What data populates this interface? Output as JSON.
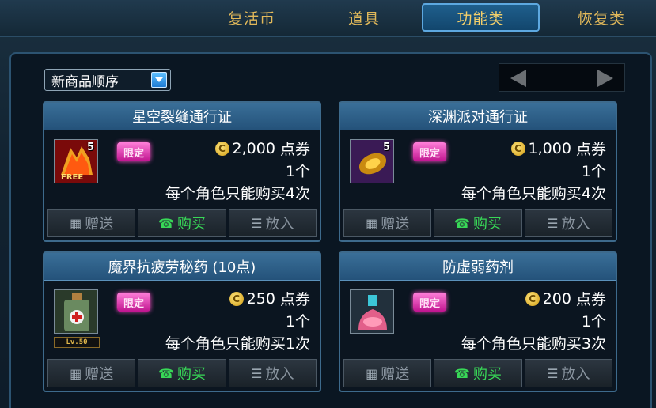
{
  "tabs": [
    {
      "label": "复活币"
    },
    {
      "label": "道具"
    },
    {
      "label": "功能类",
      "active": true
    },
    {
      "label": "恢复类"
    }
  ],
  "sort": {
    "label": "新商品顺序"
  },
  "currency_unit": "点券",
  "limited_label": "限定",
  "buttons": {
    "gift": "赠送",
    "buy": "购买",
    "cart": "放入"
  },
  "items": [
    {
      "name": "星空裂缝通行证",
      "price": "2,000",
      "qty": "1个",
      "limit": "每个角色只能购买4次",
      "badge": "5",
      "icon": "fist-pass-icon"
    },
    {
      "name": "深渊派对通行证",
      "price": "1,000",
      "qty": "1个",
      "limit": "每个角色只能购买4次",
      "badge": "5",
      "icon": "abyss-pass-icon"
    },
    {
      "name": "魔界抗疲劳秘药 (10点)",
      "price": "250",
      "qty": "1个",
      "limit": "每个角色只能购买1次",
      "level": "Lv.50",
      "icon": "potion-bottle-icon"
    },
    {
      "name": "防虚弱药剂",
      "price": "200",
      "qty": "1个",
      "limit": "每个角色只能购买3次",
      "icon": "flask-icon"
    }
  ],
  "colors": {
    "accent": "#f4cf6a",
    "buy_green": "#38d857",
    "limited_pink": "#ff4fc9"
  }
}
